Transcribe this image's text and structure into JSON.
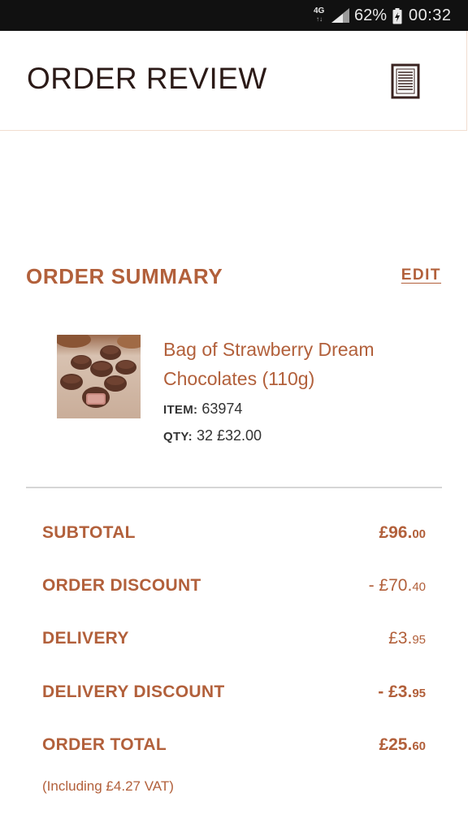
{
  "status_bar": {
    "network": "4G",
    "battery_percent": "62%",
    "time": "00:32"
  },
  "header": {
    "title": "ORDER REVIEW",
    "icon": "document-icon"
  },
  "summary": {
    "heading": "ORDER SUMMARY",
    "edit_label": "EDIT",
    "item": {
      "name": "Bag of Strawberry Dream Chocolates (110g)",
      "item_label": "ITEM:",
      "item_number": "63974",
      "qty_label": "QTY:",
      "qty_value": "32 £32.00"
    }
  },
  "totals": {
    "subtotal": {
      "label": "SUBTOTAL",
      "major": "£96.",
      "minor": "00"
    },
    "order_discount": {
      "label": "ORDER DISCOUNT",
      "major": "- £70.",
      "minor": "40"
    },
    "delivery": {
      "label": "DELIVERY",
      "major": "£3.",
      "minor": "95"
    },
    "delivery_discount": {
      "label": "DELIVERY DISCOUNT",
      "major": "- £3.",
      "minor": "95"
    },
    "order_total": {
      "label": "ORDER TOTAL",
      "major": "£25.",
      "minor": "60"
    },
    "vat_note": "(Including £4.27 VAT)"
  },
  "colors": {
    "accent": "#b2603b",
    "title": "#2b1a17",
    "status_bar": "#111111"
  }
}
